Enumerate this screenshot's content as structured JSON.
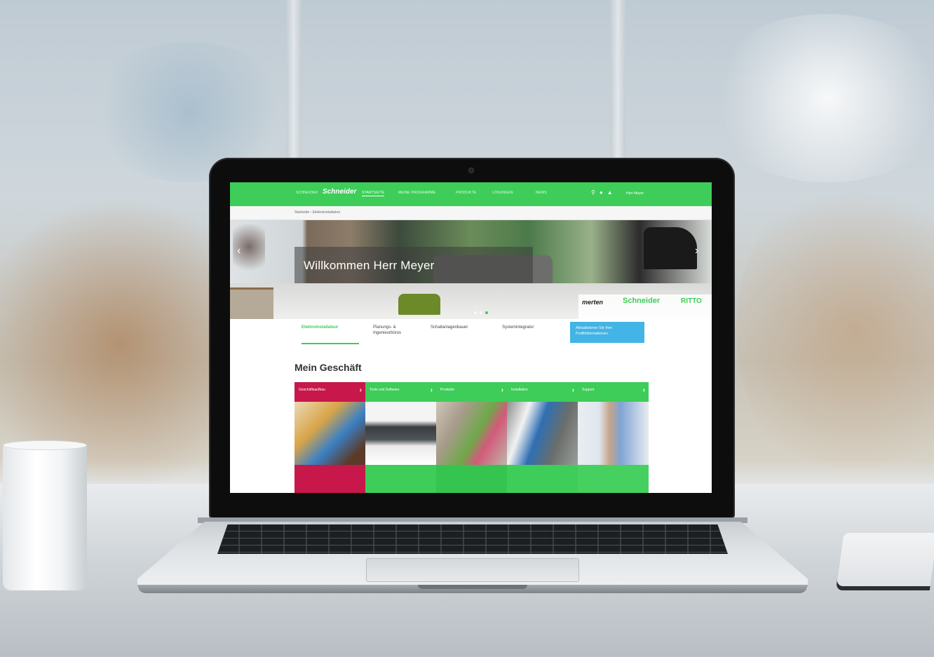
{
  "site": {
    "nav": {
      "items": [
        "SCHNEIDER",
        "STARTSEITE",
        "MEINE PROGRAMME",
        "PRODUKTE",
        "LÖSUNGEN",
        "NEWS"
      ],
      "active_index": 1,
      "brand": "Schneider",
      "user": "Herr Meyer"
    },
    "breadcrumb": "Startseite › Elektroinstallateur",
    "hero": {
      "title": "Willkommen Herr Meyer",
      "prev": "‹",
      "next": "›",
      "brands": [
        "merten",
        "Schneider",
        "RITTO"
      ]
    },
    "tabs": [
      {
        "label": "Elektroinstallateur",
        "active": true
      },
      {
        "label": "Planungs- & Ingenieurbüros",
        "active": false
      },
      {
        "label": "Schaltanlagenbauer",
        "active": false
      },
      {
        "label": "Systemintegrator",
        "active": false
      }
    ],
    "cta_label": "Aktualisieren Sie Ihre Profilinformationen",
    "section_title": "Mein Geschäft",
    "cards": [
      {
        "label": "Geschäftsaufbau",
        "color": "#c8174a"
      },
      {
        "label": "Tools und Software",
        "color": "#3dcd58"
      },
      {
        "label": "Produkte",
        "color": "#3dcd58"
      },
      {
        "label": "Installation",
        "color": "#3dcd58"
      },
      {
        "label": "Support",
        "color": "#3dcd58"
      }
    ],
    "colors": {
      "brand_green": "#3dcd58",
      "accent_blue": "#42b4e6",
      "accent_red": "#c8174a"
    }
  }
}
